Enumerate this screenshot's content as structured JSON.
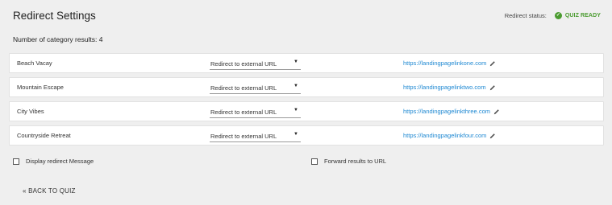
{
  "header": {
    "title": "Redirect Settings",
    "status_label": "Redirect status:",
    "status_value": "QUIZ READY",
    "status_icon": "check-circle-icon",
    "status_color": "#4a9b2f"
  },
  "summary": {
    "count_text": "Number of category results: 4"
  },
  "rows": [
    {
      "name": "Beach Vacay",
      "select": "Redirect to external URL",
      "url": "https://landingpagelinkone.com"
    },
    {
      "name": "Mountain Escape",
      "select": "Redirect to external URL",
      "url": "https://landingpagelinktwo.com"
    },
    {
      "name": "City Vibes",
      "select": "Redirect to external URL",
      "url": "https://landingpagelinkthree.com"
    },
    {
      "name": "Countryside Retreat",
      "select": "Redirect to external URL",
      "url": "https://landingpagelinkfour.com"
    }
  ],
  "options": {
    "display_redirect_label": "Display redirect Message",
    "forward_results_label": "Forward results to URL"
  },
  "footer": {
    "back_label": "« BACK TO QUIZ"
  },
  "colors": {
    "link": "#1e88d2",
    "background": "#efefef"
  }
}
